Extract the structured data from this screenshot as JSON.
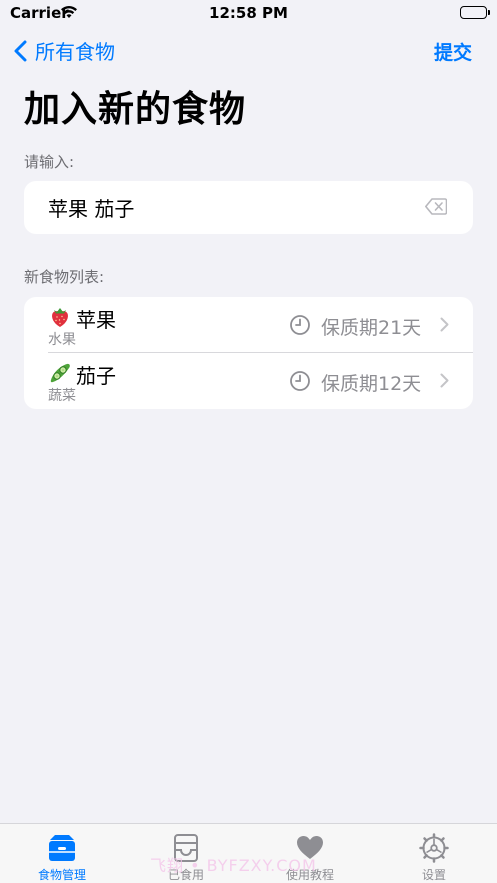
{
  "status_bar": {
    "carrier": "Carrier",
    "time": "12:58 PM"
  },
  "nav": {
    "back_label": "所有食物",
    "submit_label": "提交"
  },
  "page_title": "加入新的食物",
  "input_section": {
    "label": "请输入:",
    "value": "苹果 茄子"
  },
  "list_section": {
    "label": "新食物列表:",
    "items": [
      {
        "emoji": "strawberry",
        "name": "苹果",
        "category": "水果",
        "shelf_life": "保质期21天"
      },
      {
        "emoji": "cucumber",
        "name": "茄子",
        "category": "蔬菜",
        "shelf_life": "保质期12天"
      }
    ]
  },
  "tab_bar": {
    "tabs": [
      {
        "label": "食物管理",
        "icon": "food-box-icon",
        "active": true
      },
      {
        "label": "已食用",
        "icon": "tray-icon",
        "active": false
      },
      {
        "label": "使用教程",
        "icon": "heart-icon",
        "active": false
      },
      {
        "label": "设置",
        "icon": "gear-icon",
        "active": false
      }
    ]
  },
  "watermark": "飞翔 • BYFZXY.COM",
  "colors": {
    "accent": "#007AFF",
    "background": "#F2F2F7",
    "secondary_text": "#8E8E93"
  }
}
